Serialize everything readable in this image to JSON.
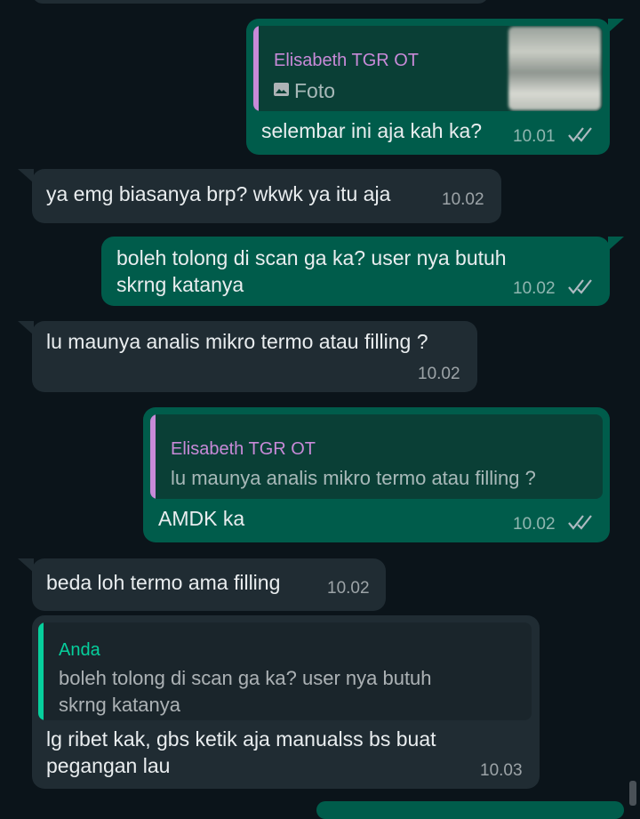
{
  "colors": {
    "background": "#0b141a",
    "outgoing_bubble": "#005c4b",
    "incoming_bubble": "#202c33",
    "quote_name_other": "#c88ad8",
    "quote_name_self": "#06cf9c"
  },
  "messages": [
    {
      "direction": "outgoing",
      "quote": {
        "author": "Elisabeth TGR OT",
        "media_icon": "photo-icon",
        "text": "Foto"
      },
      "text": "selembar ini aja kah ka?",
      "time": "10.01",
      "status": "read"
    },
    {
      "direction": "incoming",
      "text": "ya emg biasanya brp? wkwk ya itu aja",
      "time": "10.02"
    },
    {
      "direction": "outgoing",
      "lines": [
        "boleh tolong di scan ga ka? user nya butuh",
        "skrng katanya"
      ],
      "time": "10.02",
      "status": "read"
    },
    {
      "direction": "incoming",
      "text": "lu maunya analis mikro termo atau filling ?",
      "time": "10.02"
    },
    {
      "direction": "outgoing",
      "quote": {
        "author": "Elisabeth TGR OT",
        "text": "lu maunya analis mikro termo atau filling ?"
      },
      "text": "AMDK ka",
      "time": "10.02",
      "status": "read"
    },
    {
      "direction": "incoming",
      "text": "beda loh termo ama filling",
      "time": "10.02"
    },
    {
      "direction": "incoming",
      "quote": {
        "author": "Anda",
        "lines": [
          "boleh tolong di scan ga ka? user nya butuh",
          "skrng katanya"
        ]
      },
      "lines": [
        "lg ribet kak, gbs ketik aja manualss bs buat",
        "pegangan lau"
      ],
      "time": "10.03"
    }
  ]
}
